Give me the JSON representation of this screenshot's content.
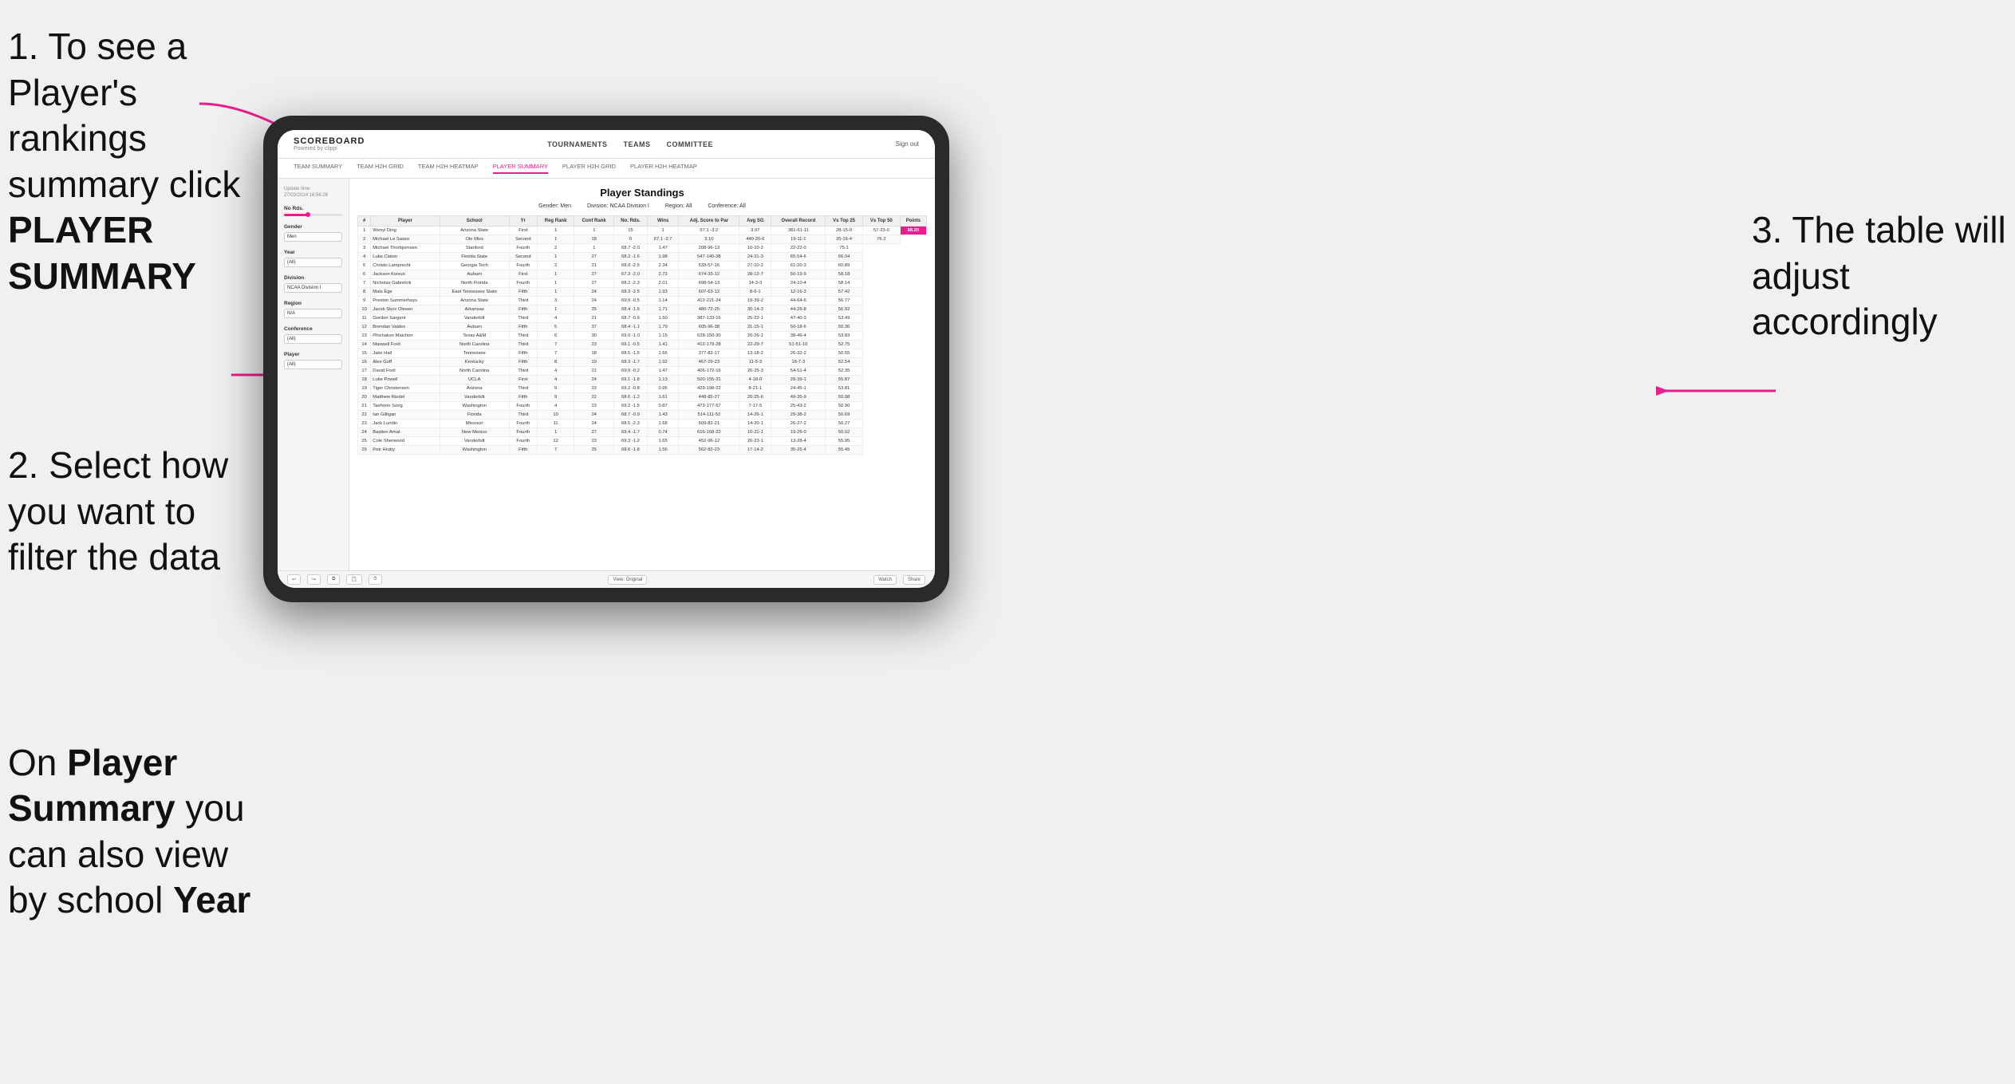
{
  "instructions": {
    "step1": "1. To see a Player's rankings summary click PLAYER SUMMARY",
    "step1_line1": "1. To see a Player's rankings",
    "step1_line2": "summary click ",
    "step1_bold": "PLAYER SUMMARY",
    "step2_line1": "2. Select how",
    "step2_line2": "you want to",
    "step2_line3": "filter the data",
    "step_on_line1": "On ",
    "step_on_bold1": "Player",
    "step_on_line2": "Summary",
    "step_on_plain": " you",
    "step_on_line3": "can also view",
    "step_on_line4": "by school ",
    "step_on_bold2": "Year",
    "step3_line1": "3. The table will",
    "step3_line2": "adjust accordingly"
  },
  "nav": {
    "logo": "SCOREBOARD",
    "logo_sub": "Powered by clippi",
    "links": [
      "TOURNAMENTS",
      "TEAMS",
      "COMMITTEE"
    ],
    "sign_in": "Sign out",
    "sub_links": [
      "TEAM SUMMARY",
      "TEAM H2H GRID",
      "TEAM H2H HEATMAP",
      "PLAYER SUMMARY",
      "PLAYER H2H GRID",
      "PLAYER H2H HEATMAP"
    ]
  },
  "sidebar": {
    "update_label": "Update time:",
    "update_time": "27/03/2024 16:56:26",
    "no_rds_label": "No Rds.",
    "gender_label": "Gender",
    "gender_value": "Men",
    "year_label": "Year",
    "year_value": "(All)",
    "division_label": "Division",
    "division_value": "NCAA Division I",
    "region_label": "Region",
    "region_value": "N/A",
    "conference_label": "Conference",
    "conference_value": "(All)",
    "player_label": "Player",
    "player_value": "(All)"
  },
  "table": {
    "title": "Player Standings",
    "gender_label": "Gender:",
    "gender_value": "Men",
    "division_label": "Division:",
    "division_value": "NCAA Division I",
    "region_label": "Region:",
    "region_value": "All",
    "conference_label": "Conference:",
    "conference_value": "All",
    "headers": [
      "#",
      "Player",
      "School",
      "Yr",
      "Reg Rank",
      "Conf Rank",
      "No. Rds.",
      "Wins",
      "Adj. Score to Par",
      "Avg SG",
      "Overall Record",
      "Vs Top 25",
      "Vs Top 50",
      "Points"
    ],
    "rows": [
      [
        "1",
        "Wenyi Ding",
        "Arizona State",
        "First",
        "1",
        "1",
        "15",
        "1",
        "67.1 -3.2",
        "3.07",
        "381-61-11",
        "28-15-0",
        "57-23-0",
        "88.20"
      ],
      [
        "2",
        "Michael Le Sasso",
        "Ole Miss",
        "Second",
        "1",
        "18",
        "0",
        "67.1 -2.7",
        "3.10",
        "440-26-6",
        "19-11-1",
        "35-16-4",
        "76.2"
      ],
      [
        "3",
        "Michael Thorbjornsen",
        "Stanford",
        "Fourth",
        "2",
        "1",
        "68.7 -2.0",
        "1.47",
        "208-96-13",
        "10-10-2",
        "22-22-0",
        "75.1"
      ],
      [
        "4",
        "Luke Claton",
        "Florida State",
        "Second",
        "1",
        "27",
        "68.2 -1.6",
        "1.98",
        "547-140-38",
        "24-31-3",
        "65-54-6",
        "66.04"
      ],
      [
        "5",
        "Christo Lamprecht",
        "Georgia Tech",
        "Fourth",
        "2",
        "21",
        "68.0 -2.5",
        "2.34",
        "533-57-16",
        "27-10-2",
        "61-20-3",
        "60.89"
      ],
      [
        "6",
        "Jackson Koivun",
        "Auburn",
        "First",
        "1",
        "27",
        "67.3 -2.0",
        "2.72",
        "674-33-12",
        "28-12-7",
        "50-19-9",
        "58.18"
      ],
      [
        "7",
        "Nicholas Gabrelcik",
        "North Florida",
        "Fourth",
        "1",
        "27",
        "68.2 -2.3",
        "2.01",
        "698-54-13",
        "14-3-3",
        "24-10-4",
        "58.14"
      ],
      [
        "8",
        "Mats Ege",
        "East Tennessee State",
        "Fifth",
        "1",
        "24",
        "68.3 -2.5",
        "1.93",
        "607-63-12",
        "8-6-1",
        "12-16-3",
        "57.42"
      ],
      [
        "9",
        "Preston Summerhays",
        "Arizona State",
        "Third",
        "3",
        "24",
        "69.0 -0.5",
        "1.14",
        "412-221-24",
        "19-39-2",
        "44-64-6",
        "56.77"
      ],
      [
        "10",
        "Jacob Skov Olesen",
        "Arkansas",
        "Fifth",
        "1",
        "25",
        "68.4 -1.5",
        "1.71",
        "480-72-25",
        "30-14-3",
        "44-26-8",
        "56.92"
      ],
      [
        "11",
        "Gordon Sargent",
        "Vanderbilt",
        "Third",
        "4",
        "21",
        "68.7 -0.9",
        "1.50",
        "387-133-16",
        "25-22-1",
        "47-40-3",
        "53.49"
      ],
      [
        "12",
        "Brendan Valdes",
        "Auburn",
        "Fifth",
        "5",
        "37",
        "68.4 -1.1",
        "1.79",
        "605-96-38",
        "31-15-1",
        "50-18-6",
        "50.36"
      ],
      [
        "13",
        "Phichaksn Maichon",
        "Texas A&M",
        "Third",
        "6",
        "30",
        "69.0 -1.0",
        "1.15",
        "628-150-30",
        "20-26-1",
        "38-46-4",
        "53.83"
      ],
      [
        "14",
        "Maxwell Ford",
        "North Carolina",
        "Third",
        "7",
        "23",
        "69.1 -0.5",
        "1.41",
        "412-179-28",
        "22-29-7",
        "51-51-10",
        "52.75"
      ],
      [
        "15",
        "Jake Hall",
        "Tennessee",
        "Fifth",
        "7",
        "18",
        "68.5 -1.5",
        "1.66",
        "377-82-17",
        "13-18-2",
        "26-32-2",
        "50.55"
      ],
      [
        "16",
        "Alex Goff",
        "Kentucky",
        "Fifth",
        "8",
        "19",
        "68.3 -1.7",
        "1.92",
        "467-29-23",
        "11-5-3",
        "18-7-3",
        "52.54"
      ],
      [
        "17",
        "David Ford",
        "North Carolina",
        "Third",
        "4",
        "21",
        "69.0 -0.2",
        "1.47",
        "406-172-16",
        "26-25-3",
        "54-51-4",
        "52.35"
      ],
      [
        "18",
        "Luke Powell",
        "UCLA",
        "First",
        "4",
        "24",
        "69.1 -1.8",
        "1.13",
        "500-155-31",
        "4-18-0",
        "28-39-1",
        "55.87"
      ],
      [
        "19",
        "Tiger Christensen",
        "Arizona",
        "Third",
        "5",
        "23",
        "69.2 -0.8",
        "0.96",
        "429-198-22",
        "8-21-1",
        "24-45-1",
        "53.81"
      ],
      [
        "20",
        "Matthew Riedel",
        "Vanderbilt",
        "Fifth",
        "9",
        "22",
        "68.6 -1.2",
        "1.61",
        "448-85-27",
        "20-25-6",
        "49-35-9",
        "50.98"
      ],
      [
        "21",
        "Taehoon Song",
        "Washington",
        "Fourth",
        "4",
        "23",
        "69.2 -1.5",
        "0.87",
        "473-177-57",
        "7-17-5",
        "25-43-2",
        "50.90"
      ],
      [
        "22",
        "Ian Gilligan",
        "Florida",
        "Third",
        "10",
        "24",
        "68.7 -0.9",
        "1.43",
        "514-111-52",
        "14-26-1",
        "29-38-2",
        "50.69"
      ],
      [
        "23",
        "Jack Lundin",
        "Missouri",
        "Fourth",
        "11",
        "24",
        "68.5 -2.3",
        "1.68",
        "509-82-21",
        "14-20-1",
        "26-27-2",
        "50.27"
      ],
      [
        "24",
        "Bastien Amat",
        "New Mexico",
        "Fourth",
        "1",
        "27",
        "69.4 -1.7",
        "0.74",
        "616-168-22",
        "10-21-1",
        "19-26-0",
        "50.02"
      ],
      [
        "25",
        "Cole Sherwood",
        "Vanderbilt",
        "Fourth",
        "12",
        "23",
        "69.3 -1.2",
        "1.65",
        "452-96-12",
        "26-23-1",
        "13-28-4",
        "55.95"
      ],
      [
        "26",
        "Petr Hruby",
        "Washington",
        "Fifth",
        "7",
        "25",
        "68.6 -1.8",
        "1.56",
        "562-82-23",
        "17-14-2",
        "35-26-4",
        "55.45"
      ]
    ]
  },
  "toolbar": {
    "view_label": "View: Original",
    "watch_label": "Watch",
    "share_label": "Share"
  }
}
